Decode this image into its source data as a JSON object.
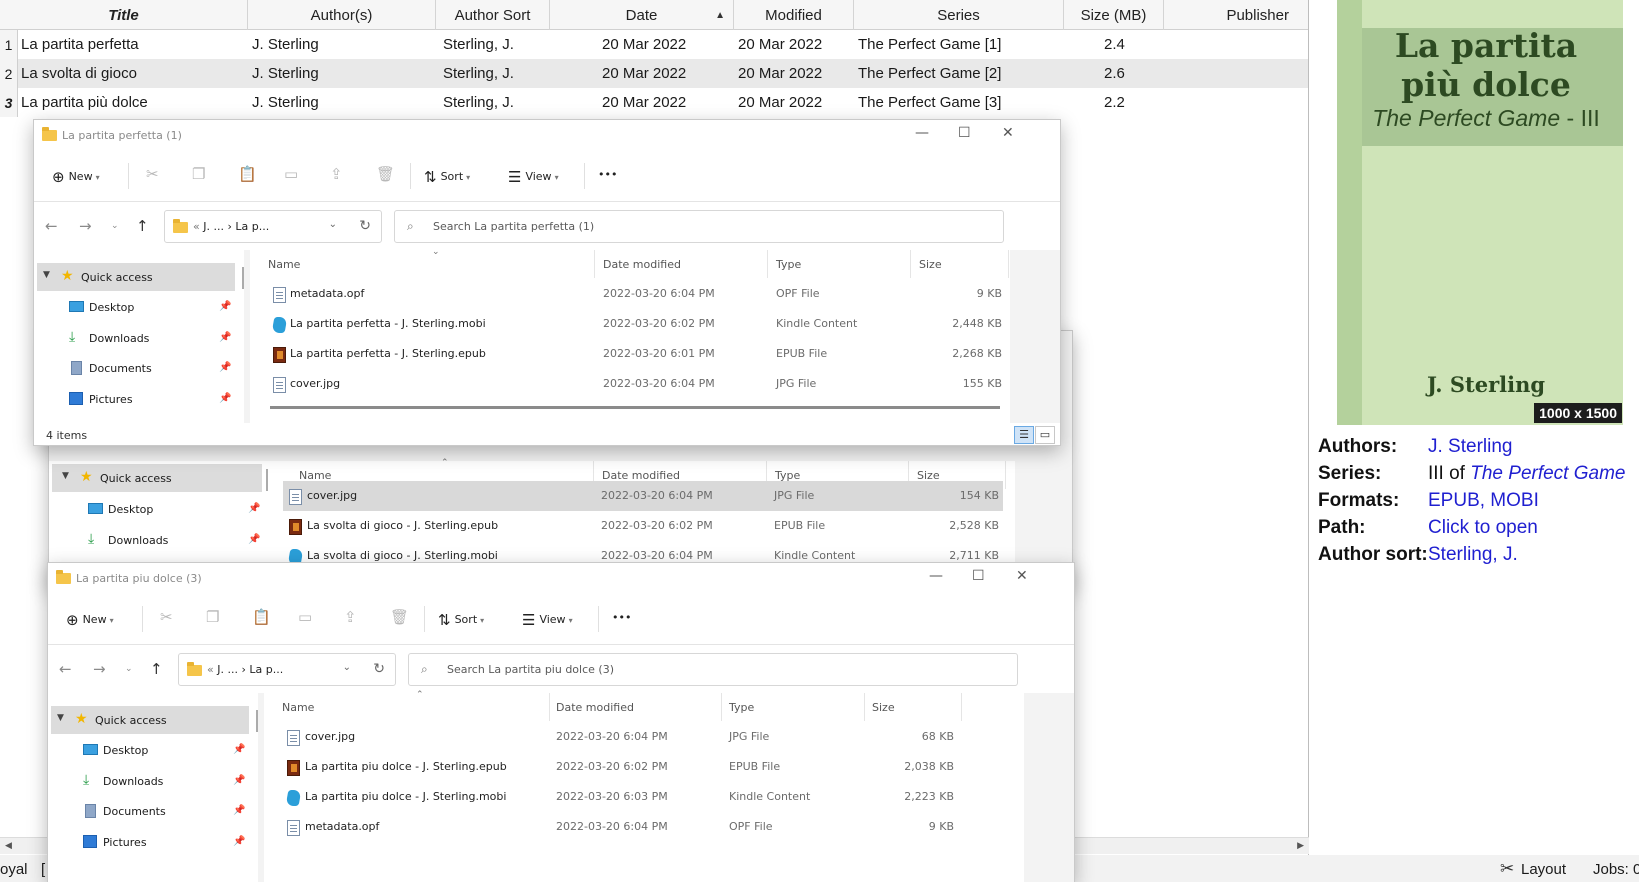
{
  "library": {
    "columns": [
      {
        "label": "Title"
      },
      {
        "label": "Author(s)"
      },
      {
        "label": "Author Sort"
      },
      {
        "label": "Date"
      },
      {
        "label": "Modified"
      },
      {
        "label": "Series"
      },
      {
        "label": "Size (MB)"
      },
      {
        "label": "Publisher"
      }
    ],
    "rows": [
      {
        "num": "1",
        "title": "La partita perfetta",
        "author": "J. Sterling",
        "author_sort": "Sterling, J.",
        "date": "20 Mar 2022",
        "modified": "20 Mar 2022",
        "series": "The Perfect Game [1]",
        "size": "2.4"
      },
      {
        "num": "2",
        "title": "La svolta di gioco",
        "author": "J. Sterling",
        "author_sort": "Sterling, J.",
        "date": "20 Mar 2022",
        "modified": "20 Mar 2022",
        "series": "The Perfect Game [2]",
        "size": "2.6"
      },
      {
        "num": "3",
        "title": "La partita più dolce",
        "author": "J. Sterling",
        "author_sort": "Sterling, J.",
        "date": "20 Mar 2022",
        "modified": "20 Mar 2022",
        "series": "The Perfect Game [3]",
        "size": "2.2"
      }
    ]
  },
  "cover": {
    "title": "La partita più dolce",
    "series_name": "The Perfect Game",
    "series_sep": " - ",
    "series_num": "III",
    "author": "J. Sterling",
    "dimensions": "1000 x 1500"
  },
  "details": {
    "authors_label": "Authors:",
    "authors_value": "J. Sterling",
    "series_label": "Series:",
    "series_prefix": "III of ",
    "series_value": "The Perfect Game",
    "formats_label": "Formats:",
    "formats_value": "EPUB, MOBI",
    "path_label": "Path:",
    "path_value": "Click to open",
    "authorsort_label": "Author sort:",
    "authorsort_value": "Sterling, J."
  },
  "statusbar": {
    "left_text": "oyal",
    "left_bracket": "[",
    "layout_label": "Layout",
    "jobs_label": "Jobs: 0"
  },
  "explorer": {
    "cmd": {
      "new": "New",
      "sort": "Sort",
      "view": "View",
      "more": "•••"
    },
    "col_name": "Name",
    "col_date": "Date modified",
    "col_type": "Type",
    "col_size": "Size",
    "nav": {
      "quick_access": "Quick access",
      "desktop": "Desktop",
      "downloads": "Downloads",
      "documents": "Documents",
      "pictures": "Pictures"
    },
    "win1": {
      "title": "La partita perfetta (1)",
      "address": "J. ...  ›  La p...",
      "search_placeholder": "Search La partita perfetta (1)",
      "item_count": "4 items",
      "files": [
        {
          "name": "metadata.opf",
          "date": "2022-03-20 6:04 PM",
          "type": "OPF File",
          "size": "9 KB",
          "icon": "page"
        },
        {
          "name": "La partita perfetta - J. Sterling.mobi",
          "date": "2022-03-20 6:02 PM",
          "type": "Kindle Content",
          "size": "2,448 KB",
          "icon": "mobi"
        },
        {
          "name": "La partita perfetta - J. Sterling.epub",
          "date": "2022-03-20 6:01 PM",
          "type": "EPUB File",
          "size": "2,268 KB",
          "icon": "epub"
        },
        {
          "name": "cover.jpg",
          "date": "2022-03-20 6:04 PM",
          "type": "JPG File",
          "size": "155 KB",
          "icon": "page"
        }
      ]
    },
    "win2": {
      "files": [
        {
          "name": "cover.jpg",
          "date": "2022-03-20 6:04 PM",
          "type": "JPG File",
          "size": "154 KB",
          "icon": "page"
        },
        {
          "name": "La svolta di gioco - J. Sterling.epub",
          "date": "2022-03-20 6:02 PM",
          "type": "EPUB File",
          "size": "2,528 KB",
          "icon": "epub"
        },
        {
          "name": "La svolta di gioco - J. Sterling.mobi",
          "date": "2022-03-20 6:04 PM",
          "type": "Kindle Content",
          "size": "2,711 KB",
          "icon": "mobi"
        }
      ]
    },
    "win3": {
      "title": "La partita piu dolce (3)",
      "address": "J. ...  ›  La p...",
      "search_placeholder": "Search La partita piu dolce (3)",
      "files": [
        {
          "name": "cover.jpg",
          "date": "2022-03-20 6:04 PM",
          "type": "JPG File",
          "size": "68 KB",
          "icon": "page"
        },
        {
          "name": "La partita piu dolce - J. Sterling.epub",
          "date": "2022-03-20 6:02 PM",
          "type": "EPUB File",
          "size": "2,038 KB",
          "icon": "epub"
        },
        {
          "name": "La partita piu dolce - J. Sterling.mobi",
          "date": "2022-03-20 6:03 PM",
          "type": "Kindle Content",
          "size": "2,223 KB",
          "icon": "mobi"
        },
        {
          "name": "metadata.opf",
          "date": "2022-03-20 6:04 PM",
          "type": "OPF File",
          "size": "9 KB",
          "icon": "page"
        }
      ]
    }
  }
}
